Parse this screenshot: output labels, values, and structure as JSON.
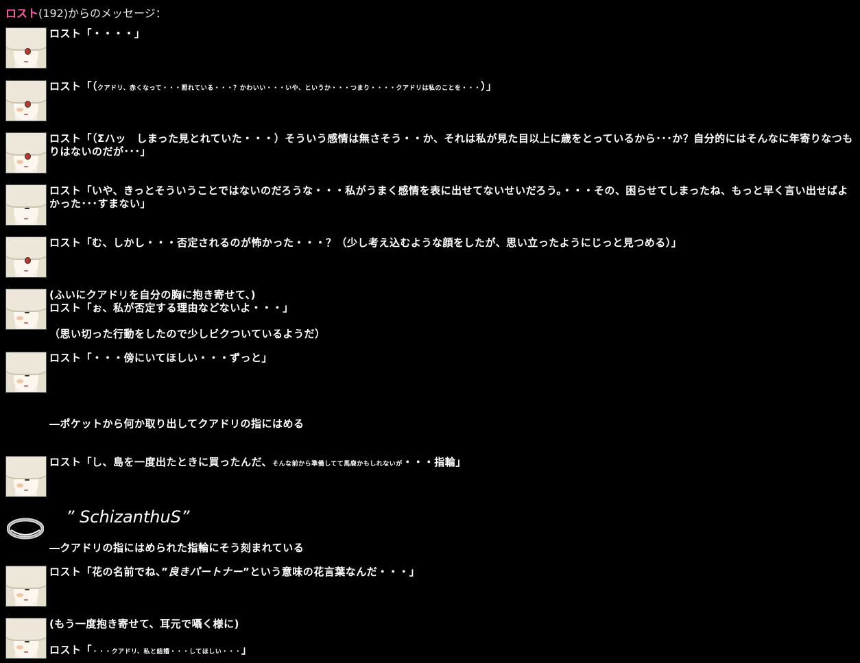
{
  "header": {
    "name": "ロスト",
    "suffix": "(192)からのメッセージ："
  },
  "messages": [
    {
      "avatar": "open",
      "text": "ロスト「・・・・」"
    },
    {
      "avatar": "open-blush",
      "prefix": "ロスト「（",
      "small": "クアドリ、赤くなって・・・照れている・・・？かわいい・・・いや、というか・・・つまり・・・・クアドリは私のことを・・・",
      "suffix": "）」"
    },
    {
      "avatar": "open-blush",
      "text": "ロスト「（Σハッ　しまった見とれていた・・・）そういう感情は無さそう・・か、それは私が見た目以上に歳をとっているから･･･か？自分的にはそんなに年寄りなつもりはないのだが･･･」"
    },
    {
      "avatar": "closed",
      "text": "ロスト「いや、きっとそういうことではないのだろうな・・・私がうまく感情を表に出せてないせいだろう。・・・その、困らせてしまったね、もっと早く言い出せばよかった･･･すまない」"
    },
    {
      "avatar": "open",
      "text": "ロスト「む、しかし・・・否定されるのが怖かった・・・？（少し考え込むような顔をしたが、思い立ったようにじっと見つめる）」"
    },
    {
      "avatar": "closed-blush",
      "lines": [
        "(ふいにクアドリを自分の胸に抱き寄せて、)",
        "ロスト「ぉ、私が否定する理由などないよ・・・」",
        "",
        "（思い切った行動をしたので少しビクついているようだ）"
      ]
    },
    {
      "avatar": "closed-blush",
      "text": "ロスト「・・・傍にいてほしい・・・ずっと」"
    },
    {
      "narration": "―ポケットから何か取り出してクアドリの指にはめる"
    },
    {
      "avatar": "closed-blush",
      "prefix": "ロスト「し、島を一度出たときに買ったんだ、",
      "small": "そんな前から準備してて馬鹿かもしれないが",
      "suffix": "・・・指輪」"
    },
    {
      "ring_inscription": "” SchizanthuS”",
      "narration2": "―クアドリの指にはめられた指輪にそう刻まれている"
    },
    {
      "avatar": "closed-blush",
      "prefix": "ロスト「花の名前でね、”",
      "italic": "良きパートナー",
      "suffix": "”という意味の花言葉なんだ・・・」"
    },
    {
      "avatar": "closed-blush",
      "lines": [
        "(もう一度抱き寄せて、耳元で囁く様に)",
        ""
      ],
      "prefix": "ロスト「",
      "small": "・・・クアドリ、私と結婚・・・してほしい・・・",
      "suffix": "」"
    }
  ]
}
